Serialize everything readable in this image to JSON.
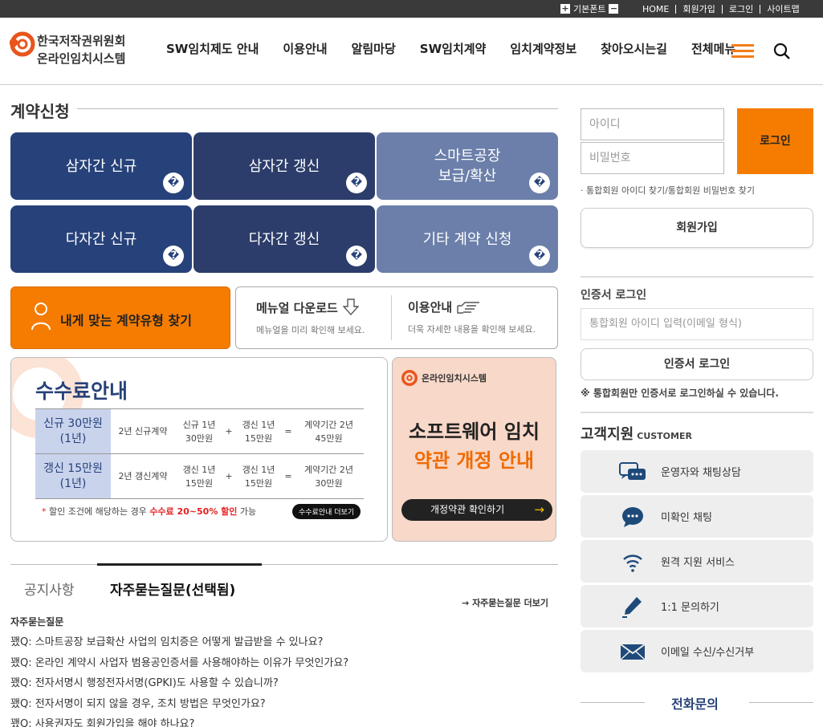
{
  "topbar": {
    "font_label": "기본폰트",
    "plus": "+",
    "minus": "−",
    "links": [
      "HOME",
      "회원가입",
      "로그인",
      "사이트맵"
    ]
  },
  "header": {
    "logo_line1": "한국저작권위원회",
    "logo_line2": "온라인임치시스템",
    "nav": [
      "SW임치제도 안내",
      "이용안내",
      "알림마당",
      "SW임치계약",
      "임치계약정보",
      "찾아오시는길",
      "전체메뉴"
    ]
  },
  "contract": {
    "title": "계약신청",
    "tiles": [
      {
        "label": "삼자간 신규"
      },
      {
        "label": "삼자간 갱신"
      },
      {
        "label": "스마트공장\n보급/확산"
      },
      {
        "label": "다자간 신규"
      },
      {
        "label": "다자간 갱신"
      },
      {
        "label": "기타 계약 신청"
      }
    ],
    "tile_go_glyph": "�",
    "find_type": "내게 맞는 계약유형 찾기",
    "manual_title": "메뉴얼 다운로드",
    "manual_desc": "메뉴얼을 미리 확인해 보세요.",
    "guide_title": "이용안내",
    "guide_desc": "더욱 자세한 내용을 확인해 보세요."
  },
  "fee": {
    "title": "수수료안내",
    "rows": [
      {
        "head": "신규 30만원\n(1년)",
        "desc": "2년 신규계약",
        "a": "신규 1년\n30만원",
        "op1": "+",
        "b": "갱신 1년\n15만원",
        "op2": "=",
        "total": "계약기간 2년\n45만원"
      },
      {
        "head": "갱신 15만원\n(1년)",
        "desc": "2년 갱신계약",
        "a": "갱신 1년\n15만원",
        "op1": "+",
        "b": "갱신 1년\n15만원",
        "op2": "=",
        "total": "계약기간 2년\n30만원"
      }
    ],
    "note_star": "*",
    "note_text": " 할인 조건에 해당하는 경우 ",
    "note_bold": "수수료 20~50% 할인",
    "note_tail": " 가능",
    "more": "수수료안내 더보기"
  },
  "banner": {
    "logo": "온라인임치시스템",
    "line1": "소프트웨어 임치",
    "line2": "약관 개정 안내",
    "button": "개정약관 확인하기",
    "arrow": "→"
  },
  "board": {
    "tab1": "공지사항",
    "tab2": "자주묻는질문(선택됨)",
    "more": "자주묻는질문 더보기",
    "more_arrow": "→",
    "heading": "자주묻는질문",
    "items": [
      "꽸Q: 스마트공장 보급확산 사업의 임치증은 어떻게 발급받을 수 있나요?",
      "꽸Q: 온라인 계약시 사업자 범용공인증서를 사용해야하는 이유가 무엇인가요?",
      "꽸Q: 전자서명시 행정전자서명(GPKI)도 사용할 수 있습니까?",
      "꽸Q: 전자서명이 되지 않을 경우, 조치 방법은 무엇인가요?",
      "꽸Q: 사용권자도 회원가입을 해야 하나요?"
    ]
  },
  "login": {
    "id_placeholder": "아이디",
    "pw_placeholder": "비밀번호",
    "button": "로그인",
    "find": "· 통합회원 아이디 찾기/통합회원 비밀번호 찾기",
    "join": "회원가입",
    "cert_title": "인증서 로그인",
    "cert_placeholder": "통합회원 아이디 입력(이메일 형식)",
    "cert_button": "인증서 로그인",
    "cert_note": "※ 통합회원만 인증서로 로그인하실 수 있습니다."
  },
  "customer": {
    "title": "고객지원",
    "subtitle": "CUSTOMER",
    "items": [
      "운영자와 채팅상담",
      "미확인 채팅",
      "원격 지원 서비스",
      "1:1 문의하기",
      "이메일 수신/수신거부"
    ],
    "phone_title": "전화문의"
  },
  "colors": {
    "accent_orange": "#f57c00",
    "navy": "#27427a",
    "light_navy": "#6b7faa"
  }
}
